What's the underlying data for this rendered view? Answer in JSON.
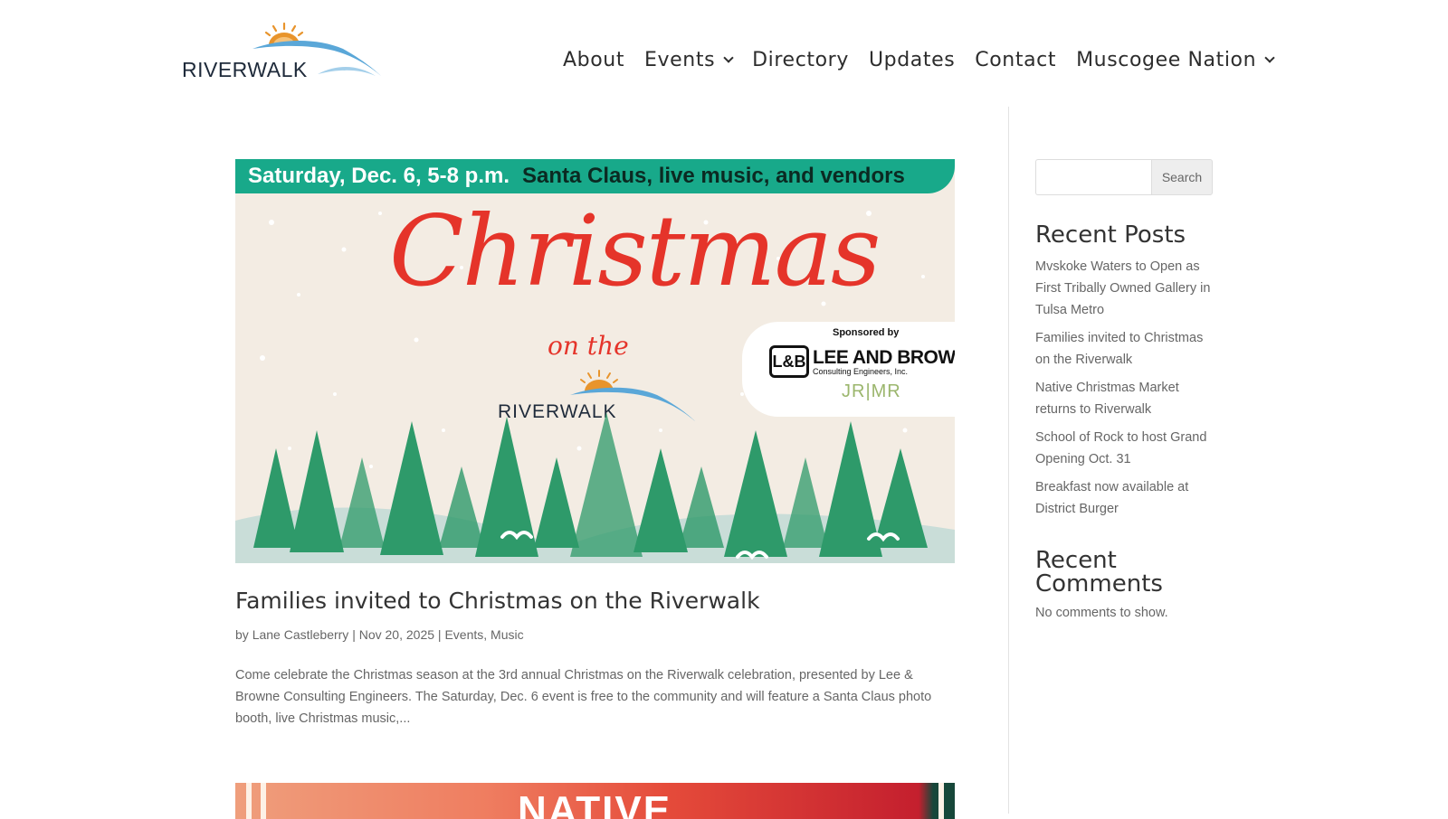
{
  "site": {
    "logo_text": "RIVERWALK",
    "brand_colors": {
      "logo_sun": "#e8942c",
      "logo_wave": "#5aa7d8",
      "logo_text": "#1e2a3a"
    }
  },
  "nav": {
    "items": [
      {
        "label": "About",
        "has_dropdown": false
      },
      {
        "label": "Events",
        "has_dropdown": true
      },
      {
        "label": "Directory",
        "has_dropdown": false
      },
      {
        "label": "Updates",
        "has_dropdown": false
      },
      {
        "label": "Contact",
        "has_dropdown": false
      },
      {
        "label": "Muscogee Nation",
        "has_dropdown": true
      }
    ]
  },
  "featured_post": {
    "image": {
      "banner_date": "Saturday, Dec. 6, 5-8 p.m.",
      "banner_desc": "Santa Claus, live music, and vendors",
      "script_title": "Christmas",
      "script_sub": "on the",
      "logo_text": "RIVERWALK",
      "sponsor_label": "Sponsored by",
      "sponsor_mark": "L&B",
      "sponsor_name": "LEE AND BROWNE",
      "sponsor_sub": "Consulting Engineers, Inc.",
      "sponsor2": "JR|MR",
      "colors": {
        "banner": "#18a98a",
        "title": "#e5342a",
        "background": "#f3ece3",
        "trees": "#2e9a6a"
      }
    },
    "title": "Families invited to Christmas on the Riverwalk",
    "meta": {
      "by": "by",
      "author": "Lane Castleberry",
      "sep1": "|",
      "date": "Nov 20, 2025",
      "sep2": "|",
      "category1": "Events",
      "comma": ",",
      "category2": "Music"
    },
    "excerpt": "Come celebrate the Christmas season at the 3rd annual Christmas on the Riverwalk celebration, presented by Lee & Browne Consulting Engineers. The Saturday, Dec. 6 event is free to the community and will feature a Santa Claus photo booth, live Christmas music,..."
  },
  "next_post": {
    "image_text": "NATIVE"
  },
  "sidebar": {
    "search": {
      "placeholder": "",
      "button_label": "Search"
    },
    "recent_posts": {
      "title": "Recent Posts",
      "items": [
        "Mvskoke Waters to Open as First Tribally Owned Gallery in Tulsa Metro",
        "Families invited to Christmas on the Riverwalk",
        "Native Christmas Market returns to Riverwalk",
        "School of Rock to host Grand Opening Oct. 31",
        "Breakfast now available at District Burger"
      ]
    },
    "recent_comments": {
      "title": "Recent Comments",
      "empty_text": "No comments to show."
    }
  }
}
